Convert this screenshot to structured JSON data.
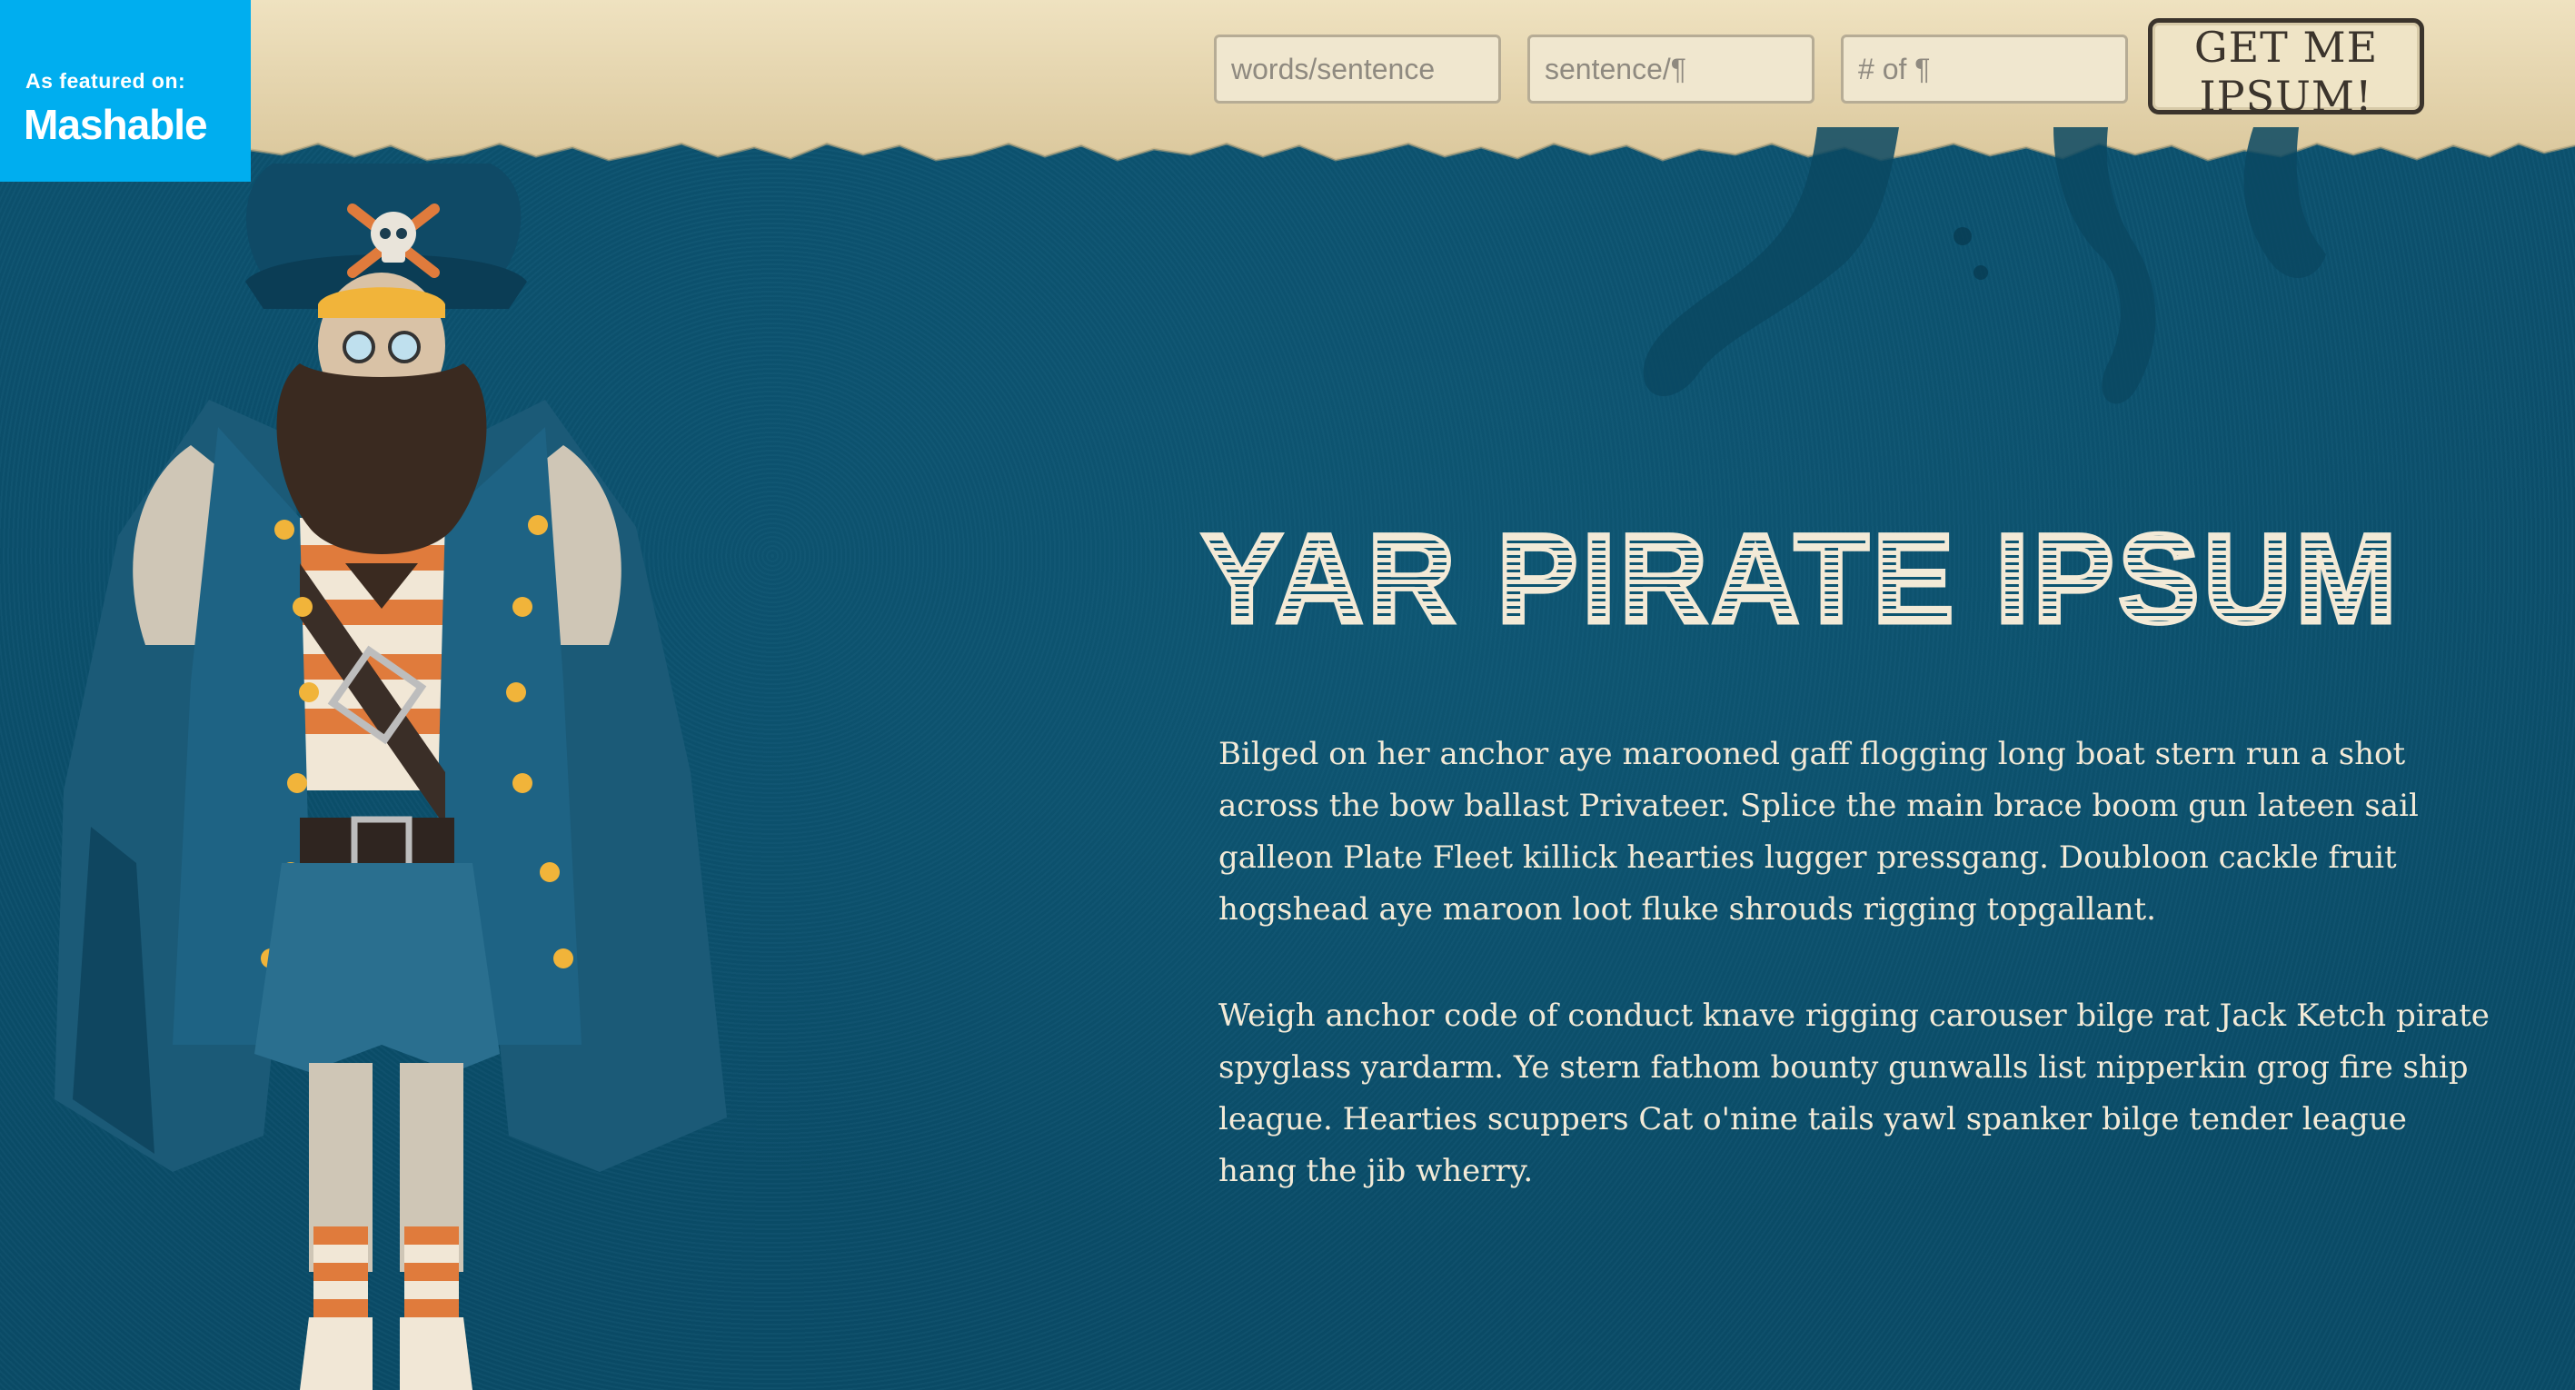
{
  "badge": {
    "featured": "As featured on:",
    "brand": "Mashable"
  },
  "form": {
    "words_placeholder": "words/sentence",
    "sentences_placeholder": "sentence/¶",
    "paragraphs_placeholder": "# of ¶",
    "submit_label": "GET ME IPSUM!"
  },
  "hero": {
    "title": "YAR PIRATE IPSUM"
  },
  "paragraphs": [
    "Bilged on her anchor aye marooned gaff flogging long boat stern run a shot across the bow ballast Privateer. Splice the main brace boom gun lateen sail galleon Plate Fleet killick hearties lugger pressgang. Doubloon cackle fruit hogshead aye maroon loot fluke shrouds rigging topgallant.",
    "Weigh anchor code of conduct knave rigging carouser bilge rat Jack Ketch pirate spyglass yardarm. Ye stern fathom bounty gunwalls list nipperkin grog fire ship league. Hearties scuppers Cat o'nine tails yawl spanker bilge tender league hang the jib wherry."
  ],
  "colors": {
    "background": "#0d5470",
    "parchment": "#e3d3ad",
    "badge": "#00aeef",
    "text": "#f3ead7",
    "pirate_coat": "#1d5a78",
    "pirate_stripe": "#e07b3c"
  },
  "icons": {
    "hat_emblem": "skull-crossbones-icon"
  }
}
